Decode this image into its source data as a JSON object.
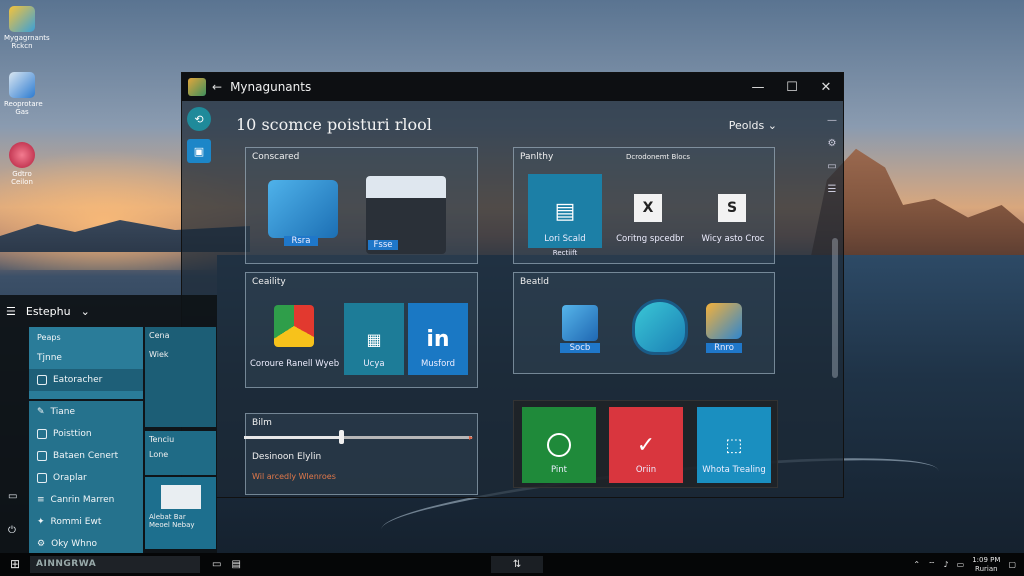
{
  "desktop": {
    "icons": [
      {
        "label": "Mygagrnants\nRckcn",
        "icon": "app-icon"
      },
      {
        "label": "Reoprotare\nGas",
        "icon": "shield-icon"
      },
      {
        "label": "Gdtro\nCeilon",
        "icon": "globe-icon"
      }
    ]
  },
  "window": {
    "title": "Mynagunants",
    "back_glyph": "←",
    "minimize": "—",
    "maximize": "☐",
    "close": "✕",
    "heading": "10 scomce poisturi rlool",
    "people_label": "Peolds",
    "panels": {
      "conscared": {
        "title": "Conscared",
        "tile_labels": [
          "Rsra",
          "Fsse"
        ]
      },
      "panlthy": {
        "title": "Panlthy",
        "subtitle": "Dcrodonemt Blocs",
        "tiles": [
          {
            "label": "Lori Scald",
            "sub": "Rectiift"
          },
          {
            "label": "Coritng spcedbr"
          },
          {
            "label": "Wicy asto Croc"
          }
        ]
      },
      "ceaility": {
        "title": "Ceaility",
        "tiles": [
          {
            "label": "Coroure Ranell Wyeb"
          },
          {
            "label": "Ucya"
          },
          {
            "label": "Musford"
          }
        ]
      },
      "beatld": {
        "title": "Beatld",
        "tile_labels": [
          "Socb",
          "Rnro"
        ]
      },
      "bilm": {
        "title": "Bilm",
        "status": "Desinoon Elylin",
        "warning": "Wil arcedly Wlenroes"
      }
    },
    "quick_tiles": [
      {
        "label": "Pint",
        "color": "#1f8a3a"
      },
      {
        "label": "Oriin",
        "color": "#d9363e"
      },
      {
        "label": "Whota Trealing",
        "color": "#1a8fc0"
      }
    ],
    "slider": {
      "value": 0.44
    }
  },
  "start_menu": {
    "title": "Estephu",
    "group_label": "Peaps",
    "items": [
      "Tjnne",
      "Eatoracher",
      "Tiane",
      "Poisttion",
      "Bataen Cenert",
      "Oraplar",
      "Canrin Marren",
      "Rommi Ewt",
      "Oky Whno"
    ],
    "active_index": 1,
    "card1_title": "Cena",
    "card1_sub": "Wiek",
    "card2_title": "Tenciu",
    "card2_sub": "Lone",
    "card3_text": "Alebat Bar\nMeoel Nebay"
  },
  "taskbar": {
    "search_text": "AINNGRWA",
    "tray_time": "1:09 PM",
    "tray_date": "Rurian"
  }
}
